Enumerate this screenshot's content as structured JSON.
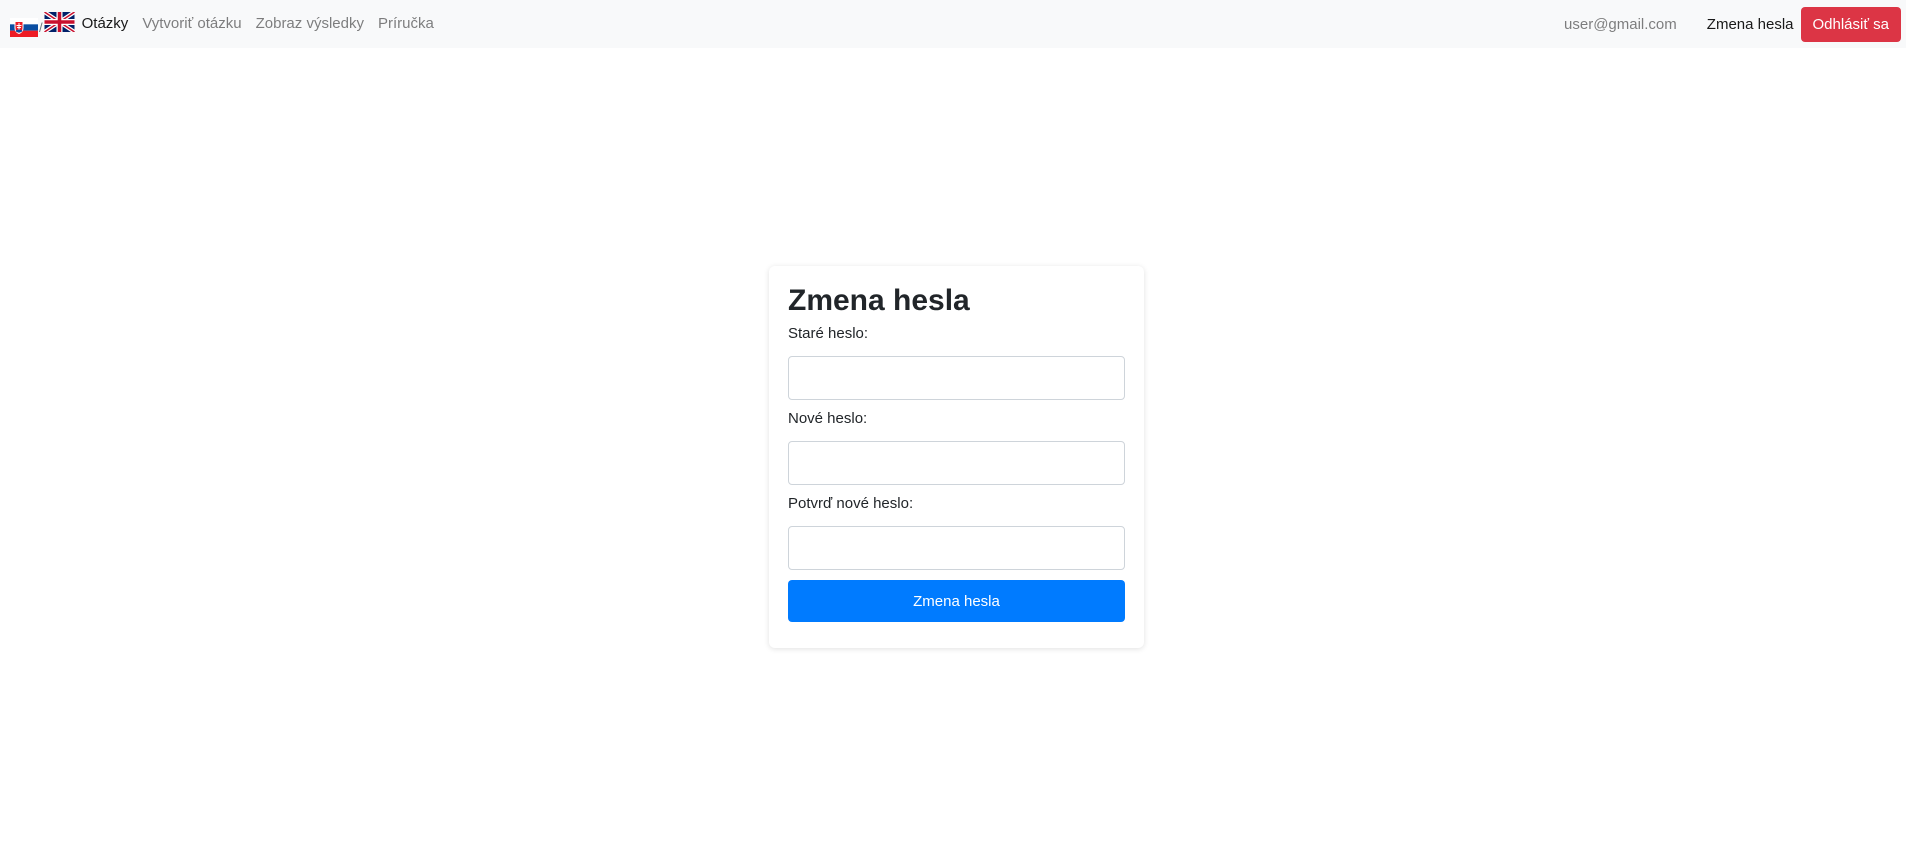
{
  "navbar": {
    "language_separator": "/",
    "links": [
      {
        "label": "Otázky",
        "active": true
      },
      {
        "label": "Vytvoriť otázku",
        "active": false
      },
      {
        "label": "Zobraz výsledky",
        "active": false
      },
      {
        "label": "Príručka",
        "active": false
      }
    ],
    "user_email": "user@gmail.com",
    "change_password_label": "Zmena hesla",
    "logout_label": "Odhlásiť sa"
  },
  "form": {
    "title": "Zmena hesla",
    "fields": [
      {
        "label": "Staré heslo:",
        "value": ""
      },
      {
        "label": "Nové heslo:",
        "value": ""
      },
      {
        "label": "Potvrď nové heslo:",
        "value": ""
      }
    ],
    "submit_label": "Zmena hesla"
  },
  "colors": {
    "navbar_bg": "#f8f9fa",
    "logout_red": "#dc3545",
    "submit_blue": "#007bff"
  },
  "icons": [
    "slovak-flag-icon",
    "uk-flag-icon"
  ]
}
